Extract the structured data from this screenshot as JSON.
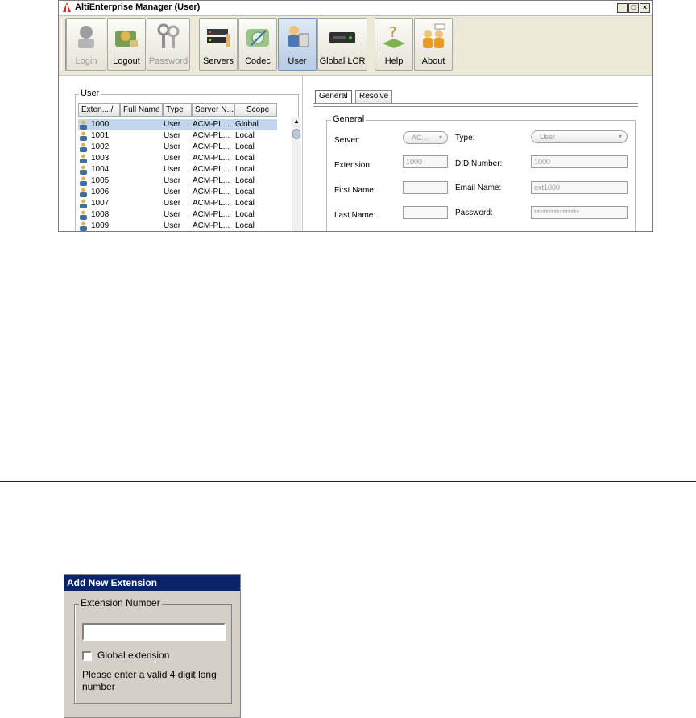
{
  "window": {
    "title": "AltiEnterprise Manager  (User)",
    "minimize": "_",
    "maximize": "□",
    "close": "×"
  },
  "toolbar": {
    "login": "Login",
    "logout": "Logout",
    "password": "Password",
    "servers": "Servers",
    "codec": "Codec",
    "user": "User",
    "global_lcr": "Global LCR",
    "help": "Help",
    "about": "About"
  },
  "user_panel": {
    "title": "User",
    "columns": [
      "Exten... /",
      "Full Name",
      "Type",
      "Server N...",
      "Scope"
    ],
    "rows": [
      {
        "ext": "1000",
        "name": "",
        "type": "User",
        "server": "ACM-PL...",
        "scope": "Global"
      },
      {
        "ext": "1001",
        "name": "",
        "type": "User",
        "server": "ACM-PL...",
        "scope": "Local"
      },
      {
        "ext": "1002",
        "name": "",
        "type": "User",
        "server": "ACM-PL...",
        "scope": "Local"
      },
      {
        "ext": "1003",
        "name": "",
        "type": "User",
        "server": "ACM-PL...",
        "scope": "Local"
      },
      {
        "ext": "1004",
        "name": "",
        "type": "User",
        "server": "ACM-PL...",
        "scope": "Local"
      },
      {
        "ext": "1005",
        "name": "",
        "type": "User",
        "server": "ACM-PL...",
        "scope": "Local"
      },
      {
        "ext": "1006",
        "name": "",
        "type": "User",
        "server": "ACM-PL...",
        "scope": "Local"
      },
      {
        "ext": "1007",
        "name": "",
        "type": "User",
        "server": "ACM-PL...",
        "scope": "Local"
      },
      {
        "ext": "1008",
        "name": "",
        "type": "User",
        "server": "ACM-PL...",
        "scope": "Local"
      },
      {
        "ext": "1009",
        "name": "",
        "type": "User",
        "server": "ACM-PL...",
        "scope": "Local"
      }
    ],
    "scroll_up": "▲"
  },
  "details": {
    "tabs": [
      "General",
      "Resolve"
    ],
    "group_title": "General",
    "server_label": "Server:",
    "server_value": "AC...",
    "type_label": "Type:",
    "type_value": "User",
    "extension_label": "Extension:",
    "extension_value": "1000",
    "did_label": "DID Number:",
    "did_value": "1000",
    "first_name_label": "First Name:",
    "first_name_value": "",
    "email_label": "Email Name:",
    "email_value": "ext1000",
    "last_name_label": "Last Name:",
    "last_name_value": "",
    "password_label": "Password:",
    "password_value": "****************",
    "caret": "▾"
  },
  "dialog": {
    "title": "Add New Extension",
    "group_title": "Extension Number",
    "input_value": "",
    "checkbox_label": "Global extension",
    "hint": "Please enter a valid 4 digit long number"
  }
}
